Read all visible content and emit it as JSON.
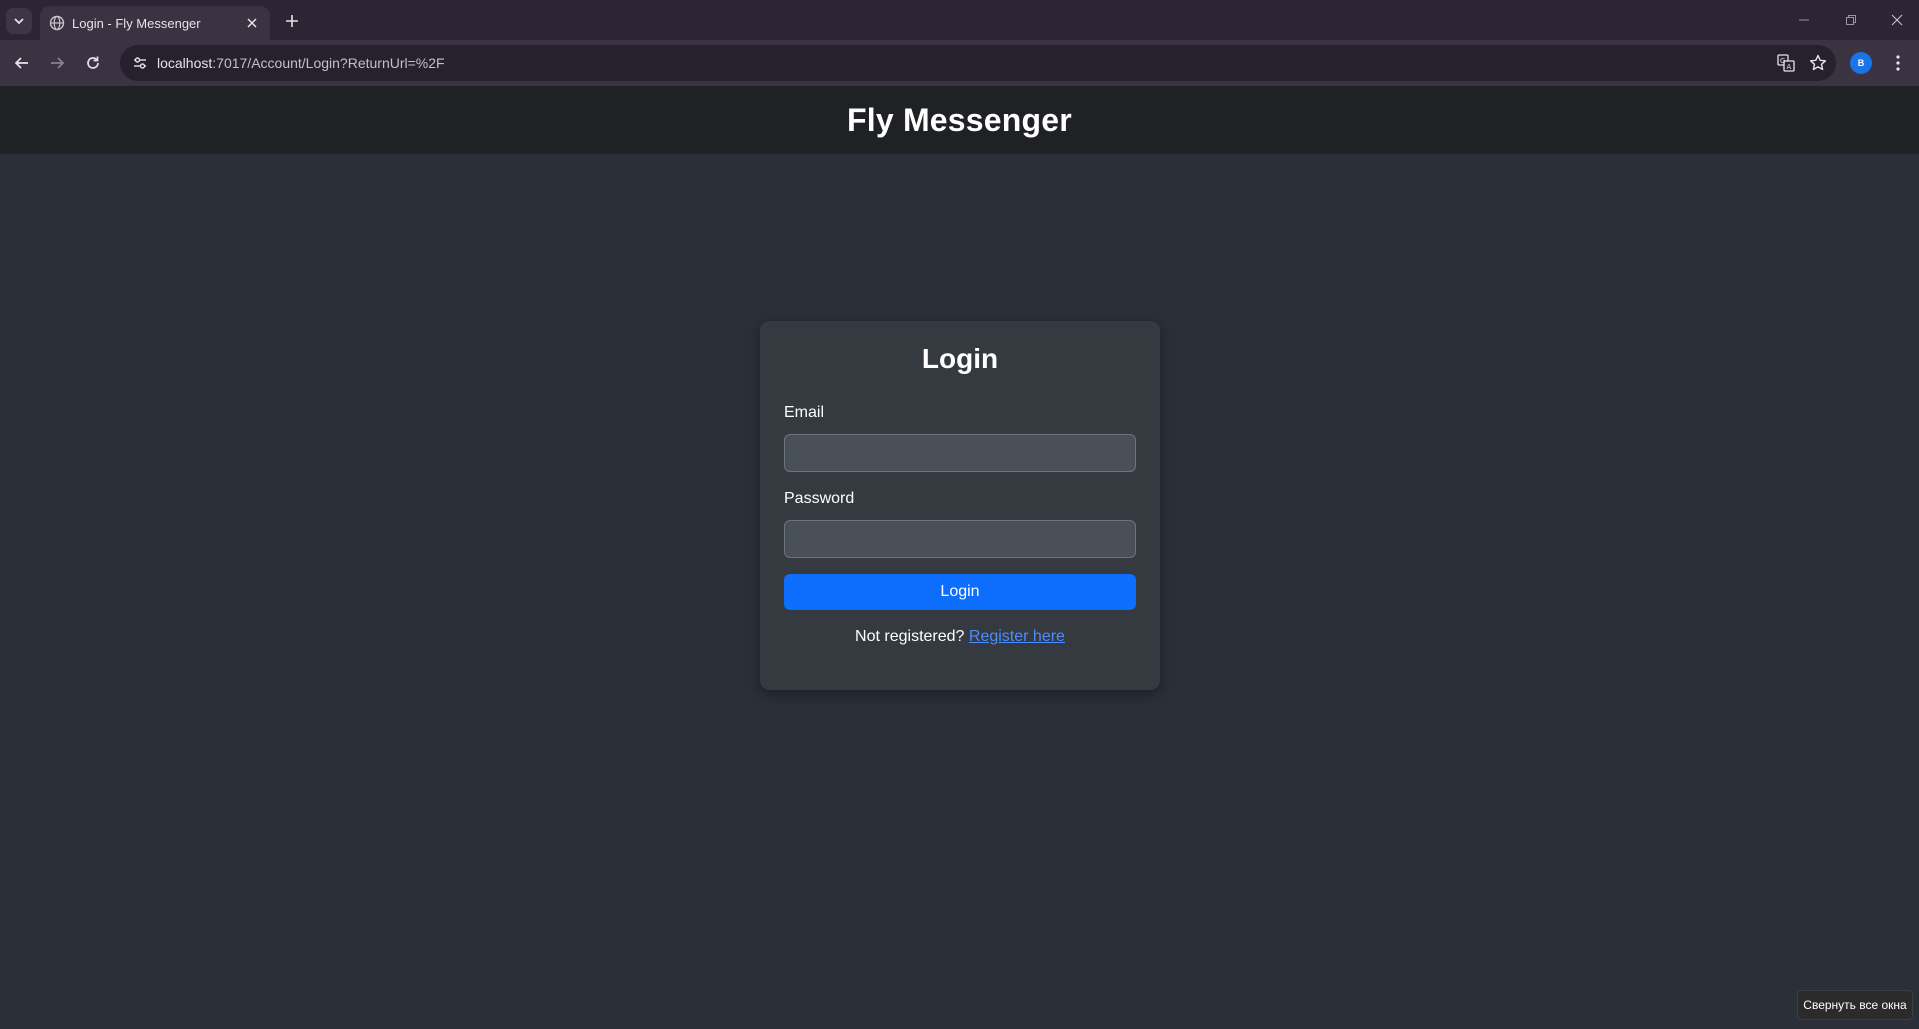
{
  "browser": {
    "tab": {
      "title": "Login - Fly Messenger",
      "favicon": "globe-icon"
    },
    "url": {
      "host": "localhost",
      "rest": ":7017/Account/Login?ReturnUrl=%2F"
    },
    "profile_initial": "B",
    "icons": {
      "tab_search": "chevron-down-icon",
      "close_tab": "close-icon",
      "new_tab": "plus-icon",
      "back": "arrow-left-icon",
      "forward": "arrow-right-icon",
      "reload": "reload-icon",
      "site_info": "tune-icon",
      "translate": "translate-icon",
      "bookmark": "star-icon",
      "menu": "kebab-icon",
      "minimize": "minimize-icon",
      "restore": "restore-icon",
      "close_window": "close-icon"
    }
  },
  "header": {
    "title": "Fly Messenger"
  },
  "login": {
    "heading": "Login",
    "email_label": "Email",
    "email_value": "",
    "password_label": "Password",
    "password_value": "",
    "submit_label": "Login",
    "not_registered_text": "Not registered? ",
    "register_link_text": "Register here"
  },
  "os_tooltip": "Свернуть все окна",
  "colors": {
    "page_bg": "#2b2f38",
    "header_bg": "#1f2125",
    "card_bg": "#343a40",
    "input_bg": "#495057",
    "primary": "#0d6efd",
    "link": "#4b8dff"
  }
}
